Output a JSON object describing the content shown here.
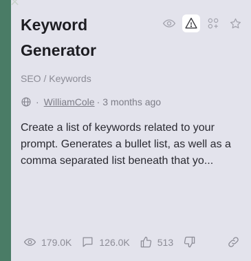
{
  "card": {
    "title": "Keyword Generator",
    "category": "SEO / Keywords",
    "author": "WilliamCole",
    "time_ago": "3 months ago",
    "separator": "·",
    "description": "Create a list of keywords related to your prompt. Generates a bullet list, as well as a comma separated list beneath that yo..."
  },
  "actions": [
    "eye-icon",
    "warning-icon",
    "grid-plus-icon",
    "star-icon"
  ],
  "stats": {
    "views": "179.0K",
    "comments": "126.0K",
    "likes": "513"
  },
  "colors": {
    "background": "#4a7c66",
    "card": "#e3e3ec",
    "text": "#1d1d22",
    "muted": "#8c8c96"
  }
}
